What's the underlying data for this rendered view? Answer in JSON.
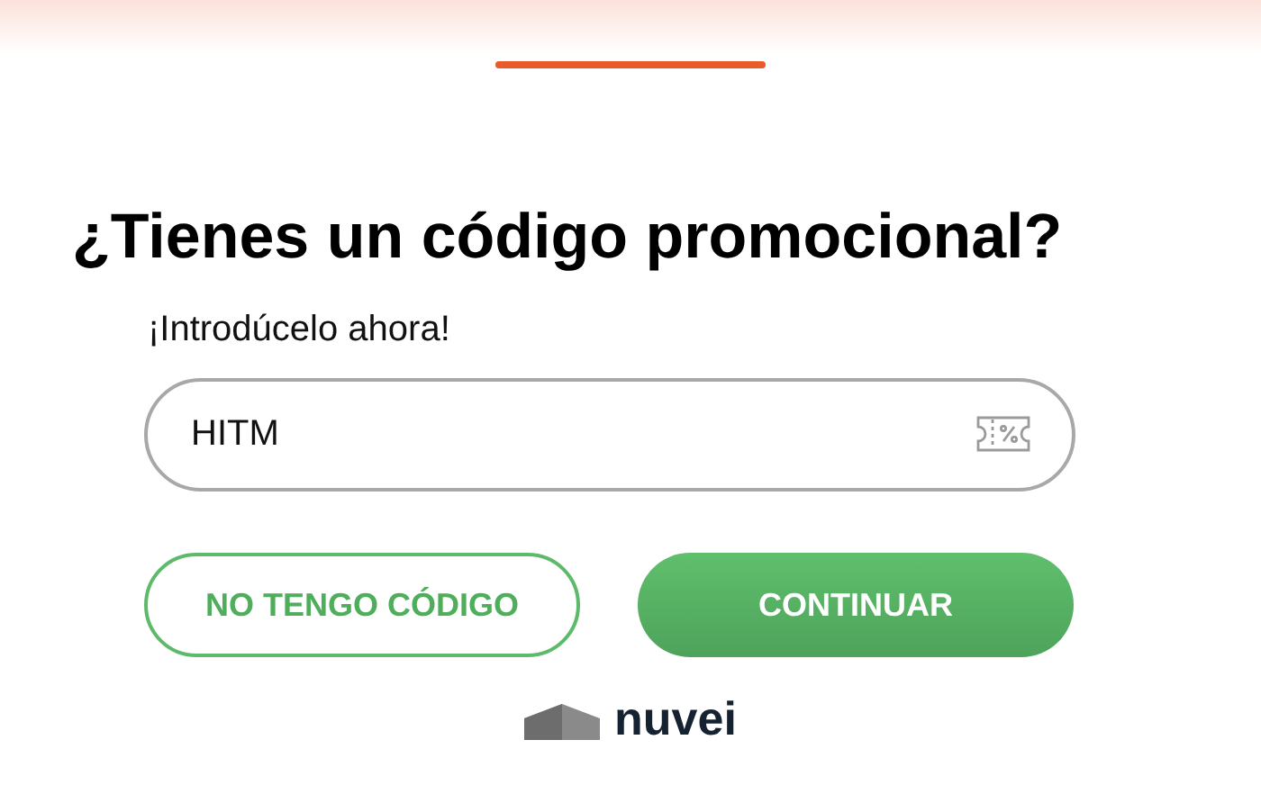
{
  "title": "¿Tienes un código promocional?",
  "subtitle": "¡Introdúcelo ahora!",
  "promo_field": {
    "value": "HITM"
  },
  "buttons": [
    {
      "label": "NO TENGO CÓDIGO",
      "kind": "secondary"
    },
    {
      "label": "CONTINUAR",
      "kind": "primary"
    }
  ],
  "footer": {
    "logo_text": "nuvei"
  }
}
